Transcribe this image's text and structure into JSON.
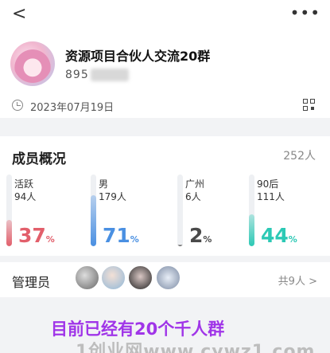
{
  "nav": {
    "back_icon": "chevron-left-icon",
    "more_icon": "more-dots-icon",
    "back_glyph": "<",
    "more_glyph": "•••"
  },
  "group": {
    "name": "资源项目合伙人交流20群",
    "id_visible": "895",
    "created_date": "2023年07月19日"
  },
  "members": {
    "title": "成员概况",
    "total": "252人",
    "stats": [
      {
        "label": "活跃",
        "count": "94人",
        "percent": 37,
        "color": "#e25f6b"
      },
      {
        "label": "男",
        "count": "179人",
        "percent": 71,
        "color": "#4a90e2"
      },
      {
        "label": "广州",
        "count": "6人",
        "percent": 2,
        "color": "#4a4a4a"
      },
      {
        "label": "90后",
        "count": "111人",
        "percent": 44,
        "color": "#2cc9b5"
      }
    ]
  },
  "admins": {
    "label": "管理员",
    "count": "共9人",
    "chevron": ">"
  },
  "overlay_text": "目前已经有20个千人群",
  "watermark": "1创业网www.cywz1.com",
  "percent_sign": "%"
}
